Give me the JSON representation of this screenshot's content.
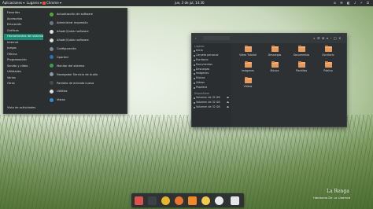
{
  "topbar": {
    "applications": "Aplicaciones ▾",
    "places": "Lugares ▾",
    "browser": "Chrome ▾",
    "clock": "jue, 3 de jul, 14:30",
    "tray": "⊙ ✉ ◧ ♪ ⚡ ⏻"
  },
  "app_menu": {
    "categories": [
      "Favoritos",
      "Accesorios",
      "Educación",
      "Gráficos",
      "Herramientas del sistema",
      "Internet",
      "Juegos",
      "Oficina",
      "Programación",
      "Sonido y vídeo",
      "Utilidades",
      "Varios",
      "Otros"
    ],
    "active_category_index": 4,
    "recent": "Vista de actividades",
    "apps": [
      {
        "label": "Actualización de software",
        "color": "#5aa63a"
      },
      {
        "label": "Administrar impresión",
        "color": "#6a7780"
      },
      {
        "label": "Añadir/Quitar software",
        "color": "#d9dfe2"
      },
      {
        "label": "Añadir/Quitar software",
        "color": "#d9dfe2"
      },
      {
        "label": "Configuración",
        "color": "#7b8a91"
      },
      {
        "label": "Gparted",
        "color": "#2e6fb5"
      },
      {
        "label": "Monitor del sistema",
        "color": "#3b9f4e"
      },
      {
        "label": "Navegador Servicio de Audio",
        "color": "#8a9ba3"
      },
      {
        "label": "Pantalla de entrada nueva",
        "color": "#4a4a4a"
      },
      {
        "label": "Utilities",
        "color": "#d9dfe2"
      },
      {
        "label": "Vistas",
        "color": "#2f8fd0"
      }
    ]
  },
  "file_manager": {
    "sidebar": {
      "places_header": "Lugares",
      "places": [
        "Inicio",
        "Carpeta personal",
        "Escritorio",
        "Documentos",
        "Descargas",
        "Imágenes",
        "Música",
        "Vídeos",
        "Papelera"
      ],
      "devices_header": "Dispositivos",
      "devices": [
        "Volumen de 32 GB",
        "Volumen de 32 GB",
        "Volumen de 32 GB"
      ],
      "eject_icon": "⏏"
    },
    "folders": [
      "Vídeo Tutorial",
      "Descargas",
      "Documentos",
      "Escritorio",
      "Imágenes",
      "Música",
      "Plantillas",
      "Público",
      "Vídeos"
    ],
    "folder_color": "#e89a5a"
  },
  "dock": {
    "icons": [
      {
        "name": "files-icon",
        "color": "#d9534f"
      },
      {
        "name": "terminal-icon",
        "color": "#3c4143"
      },
      {
        "name": "chrome-icon",
        "color": "#e5b52e"
      },
      {
        "name": "firefox-icon",
        "color": "#e8762d"
      },
      {
        "name": "vlc-icon",
        "color": "#f08a24"
      },
      {
        "name": "music-player-icon",
        "color": "#f2c94c"
      },
      {
        "name": "info-icon",
        "color": "#eaeaea"
      },
      {
        "name": "app-grid-icon",
        "color": "#e6e6e6"
      }
    ]
  },
  "desktop_text": {
    "title": "La Renga",
    "subtitle": "Hablando De La Libertad"
  }
}
